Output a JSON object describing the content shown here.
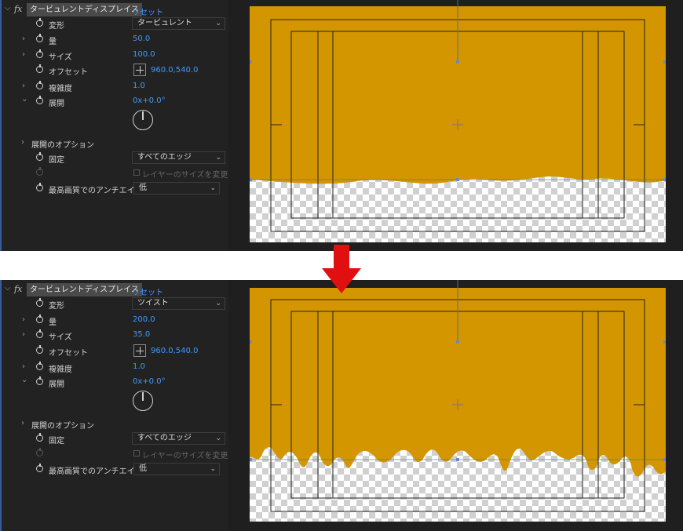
{
  "colors": {
    "accent": "#3d9bff",
    "fill": "#d39600",
    "arrow": "#e01010",
    "panel": "#222222"
  },
  "effect": {
    "fx_icon": "fx",
    "name": "タービュレントディスプレイス",
    "reset": "リセット"
  },
  "before": {
    "properties": {
      "displacement": {
        "label": "変形",
        "value": "タービュレント"
      },
      "amount": {
        "label": "量",
        "value": "50.0"
      },
      "size": {
        "label": "サイズ",
        "value": "100.0"
      },
      "offset": {
        "label": "オフセット",
        "value": "960.0,540.0"
      },
      "complexity": {
        "label": "複雑度",
        "value": "1.0"
      },
      "evolution": {
        "label": "展開",
        "value": "0x+0.0°"
      },
      "evolution_options": {
        "label": "展開のオプション"
      },
      "pinning": {
        "label": "固定",
        "value": "すべてのエッジ"
      },
      "resize_layer": {
        "label": "レイヤーのサイズを変更"
      },
      "antialias": {
        "label": "最高画質でのアンチエイリ",
        "value": "低"
      }
    }
  },
  "after": {
    "properties": {
      "displacement": {
        "label": "変形",
        "value": "ツイスト"
      },
      "amount": {
        "label": "量",
        "value": "200.0"
      },
      "size": {
        "label": "サイズ",
        "value": "35.0"
      },
      "offset": {
        "label": "オフセット",
        "value": "960.0,540.0"
      },
      "complexity": {
        "label": "複雑度",
        "value": "1.0"
      },
      "evolution": {
        "label": "展開",
        "value": "0x+0.0°"
      },
      "evolution_options": {
        "label": "展開のオプション"
      },
      "pinning": {
        "label": "固定",
        "value": "すべてのエッジ"
      },
      "resize_layer": {
        "label": "レイヤーのサイズを変更"
      },
      "antialias": {
        "label": "最高画質でのアンチエイリ",
        "value": "低"
      }
    }
  }
}
